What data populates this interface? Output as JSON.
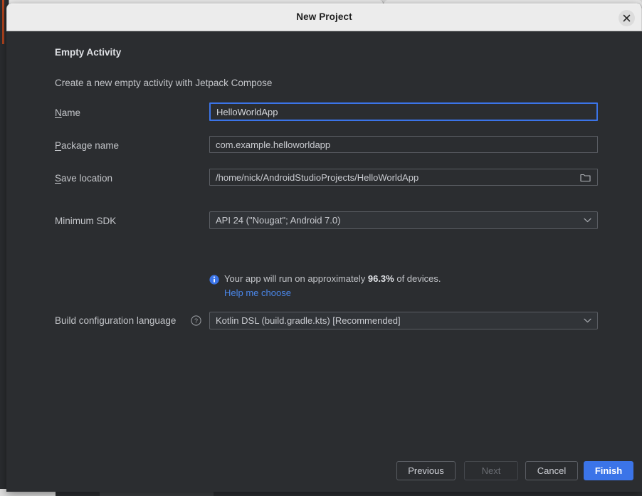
{
  "window": {
    "title": "New Project",
    "close_icon": "close-icon"
  },
  "dialog": {
    "heading": "Empty Activity",
    "subheading": "Create a new empty activity with Jetpack Compose"
  },
  "fields": {
    "name": {
      "label_prefix": "",
      "label_mnemonic": "N",
      "label_suffix": "ame",
      "value": "HelloWorldApp",
      "placeholder": ""
    },
    "package_name": {
      "label_prefix": "",
      "label_mnemonic": "P",
      "label_suffix": "ackage name",
      "value": "com.example.helloworldapp",
      "placeholder": ""
    },
    "save_location": {
      "label_prefix": "",
      "label_mnemonic": "S",
      "label_suffix": "ave location",
      "value": "/home/nick/AndroidStudioProjects/HelloWorldApp",
      "placeholder": "",
      "browse_icon": "folder-icon"
    },
    "minimum_sdk": {
      "label": "Minimum SDK",
      "selected": "API 24 (\"Nougat\"; Android 7.0)",
      "chevron_icon": "chevron-down-icon"
    },
    "build_configuration_language": {
      "label": "Build configuration language",
      "help_icon": "question-mark-icon",
      "selected": "Kotlin DSL (build.gradle.kts) [Recommended]",
      "chevron_icon": "chevron-down-icon"
    }
  },
  "info": {
    "icon": "info-icon",
    "text_before": "Your app will run on approximately ",
    "percentage": "96.3%",
    "text_after": " of devices.",
    "link": "Help me choose"
  },
  "footer": {
    "previous": "Previous",
    "next": "Next",
    "cancel": "Cancel",
    "finish": "Finish"
  },
  "colors": {
    "accent_blue": "#3b74e8",
    "link_blue": "#4a86e8",
    "dialog_bg": "#2b2d30",
    "titlebar_bg": "#ececec",
    "field_border": "#5a5d63",
    "text_primary": "#dfe1e5",
    "text_secondary": "#c3c5c9"
  }
}
